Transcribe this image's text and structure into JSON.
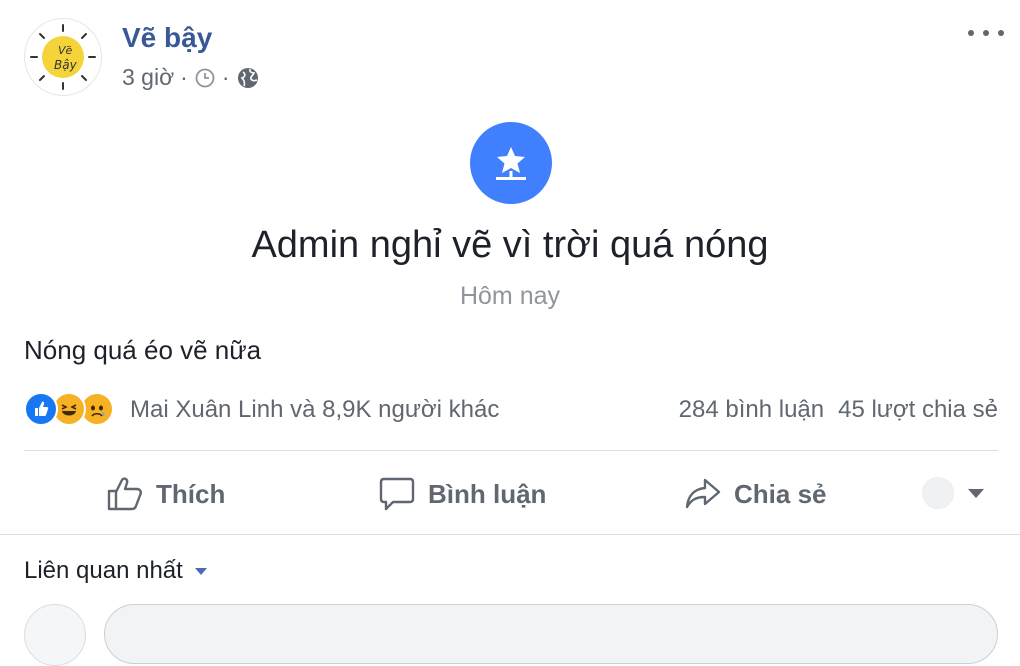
{
  "header": {
    "page_name": "Vẽ bậy",
    "timestamp": "3 giờ",
    "separator": "·"
  },
  "avatar": {
    "logo_text_1": "Vẽ",
    "logo_text_2": "Bậy"
  },
  "event": {
    "title": "Admin nghỉ vẽ vì trời quá nóng",
    "date": "Hôm nay"
  },
  "post": {
    "text": "Nóng quá éo vẽ nữa"
  },
  "reactions": {
    "icons": [
      "like-icon",
      "haha-icon",
      "sad-icon"
    ],
    "summary": "Mai Xuân Linh và 8,9K người khác",
    "comments": "284 bình luận",
    "shares": "45 lượt chia sẻ"
  },
  "actions": {
    "like": "Thích",
    "comment": "Bình luận",
    "share": "Chia sẻ"
  },
  "comments": {
    "sort_label": "Liên quan nhất"
  },
  "colors": {
    "link": "#385898",
    "event_blue": "#4080ff",
    "secondary_text": "#606770",
    "muted_text": "#90949c",
    "like_blue": "#1877f2",
    "emoji_yellow": "#f7b125"
  }
}
